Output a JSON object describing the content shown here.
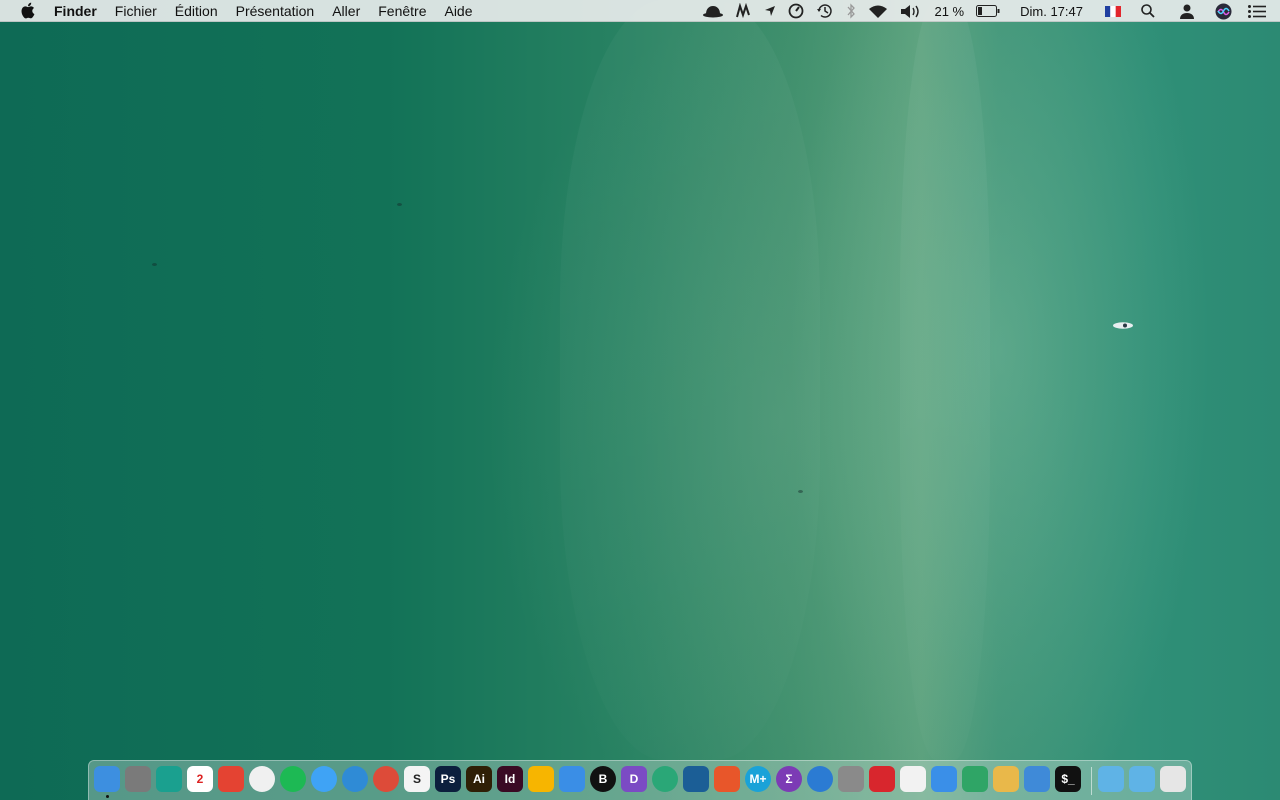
{
  "menubar": {
    "app_name": "Finder",
    "menus": [
      "Fichier",
      "Édition",
      "Présentation",
      "Aller",
      "Fenêtre",
      "Aide"
    ],
    "battery_percent": "21 %",
    "clock": "Dim. 17:47",
    "status_icons": [
      "alfred-hat-icon",
      "script-m-icon",
      "location-arrow-icon",
      "gauge-icon",
      "time-machine-icon",
      "bluetooth-icon",
      "wifi-icon",
      "volume-icon",
      "battery-icon",
      "french-flag-icon",
      "spotlight-search-icon",
      "user-icon",
      "siri-icon",
      "notification-center-icon"
    ]
  },
  "dock": {
    "apps": [
      {
        "name": "finder",
        "color": "#3d8fe0"
      },
      {
        "name": "system-preferences",
        "color": "#7a7a7a"
      },
      {
        "name": "lock-app",
        "color": "#1aa08f"
      },
      {
        "name": "calendar",
        "color": "#ffffff",
        "label": "2"
      },
      {
        "name": "todoist",
        "color": "#e44332"
      },
      {
        "name": "itunes",
        "color": "#f0f0f0"
      },
      {
        "name": "spotify",
        "color": "#1db954"
      },
      {
        "name": "messages",
        "color": "#3fa3f5"
      },
      {
        "name": "airmail",
        "color": "#2f8bd6"
      },
      {
        "name": "chrome",
        "color": "#dd4b39"
      },
      {
        "name": "sublime-slack",
        "color": "#f4f4f4",
        "label": "S"
      },
      {
        "name": "photoshop",
        "color": "#0c1f3d",
        "label": "Ps"
      },
      {
        "name": "illustrator",
        "color": "#2f1f06",
        "label": "Ai"
      },
      {
        "name": "indesign",
        "color": "#3a0a24",
        "label": "Id"
      },
      {
        "name": "sketch",
        "color": "#f7b500"
      },
      {
        "name": "transmit",
        "color": "#3a8ee6"
      },
      {
        "name": "bear-b",
        "color": "#111111",
        "label": "B"
      },
      {
        "name": "dash",
        "color": "#7b4bc4",
        "label": "D"
      },
      {
        "name": "atom",
        "color": "#2aa777"
      },
      {
        "name": "vscode",
        "color": "#1b5e96"
      },
      {
        "name": "paw",
        "color": "#e8562a"
      },
      {
        "name": "markdown-plus",
        "color": "#1aa2d8",
        "label": "M+"
      },
      {
        "name": "soulver",
        "color": "#7c3bb5",
        "label": "Σ"
      },
      {
        "name": "tableplus",
        "color": "#2b7bd3"
      },
      {
        "name": "scanner",
        "color": "#8a8a8a"
      },
      {
        "name": "fantastical-shield",
        "color": "#d8262d"
      },
      {
        "name": "robot",
        "color": "#f2f2f2"
      },
      {
        "name": "fork",
        "color": "#3a8fe8"
      },
      {
        "name": "gitkraken",
        "color": "#2fa566"
      },
      {
        "name": "sequel-pro",
        "color": "#e9b84a"
      },
      {
        "name": "transporter",
        "color": "#3f8ad8"
      },
      {
        "name": "terminal",
        "color": "#111111",
        "label": "$_"
      }
    ],
    "folders": [
      {
        "name": "downloads-folder",
        "color": "#5fb3e6"
      },
      {
        "name": "applications-folder",
        "color": "#5fb3e6"
      },
      {
        "name": "trash",
        "color": "#e6e6e6"
      }
    ]
  }
}
